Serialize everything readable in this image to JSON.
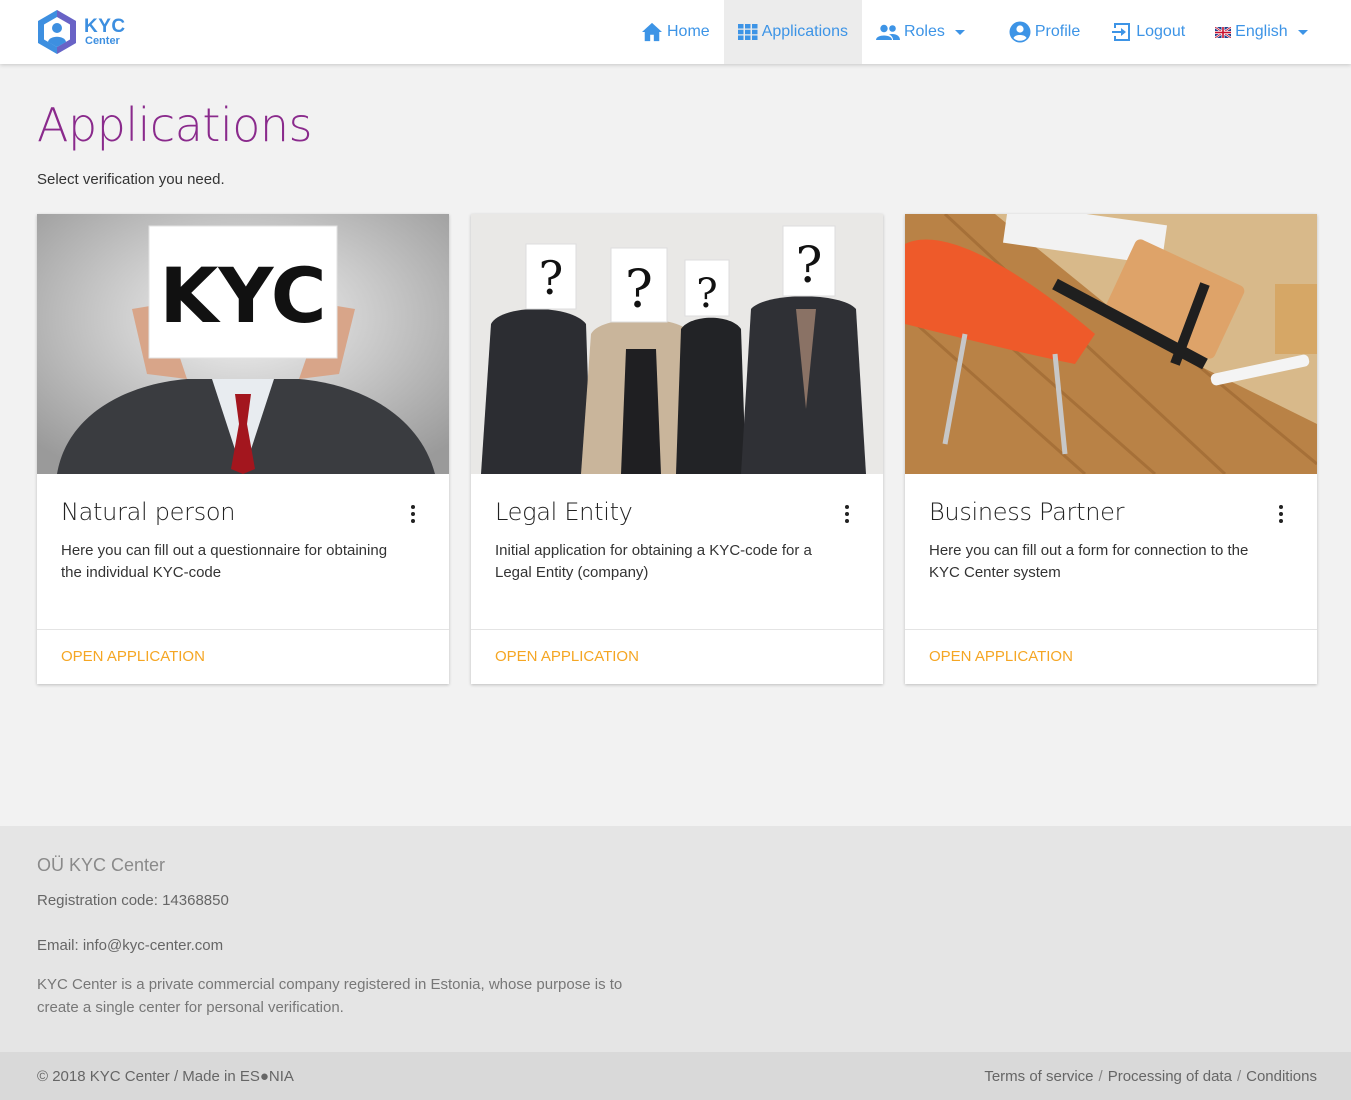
{
  "brand": {
    "line1": "KYC",
    "line2": "Center",
    "icon": "kyc-shield-logo",
    "color": "#3d8fe0"
  },
  "nav": {
    "items": [
      {
        "label": "Home",
        "icon": "home-icon"
      },
      {
        "label": "Applications",
        "icon": "apps-grid-icon",
        "active": true
      },
      {
        "label": "Roles",
        "icon": "people-icon",
        "dropdown": true
      },
      {
        "label": "Profile",
        "icon": "account-circle-icon"
      },
      {
        "label": "Logout",
        "icon": "logout-icon"
      },
      {
        "label": "English",
        "icon": "uk-flag-icon",
        "dropdown": true
      }
    ],
    "color": "#3d94e6"
  },
  "page": {
    "title": "Applications",
    "subtitle": "Select verification you need.",
    "title_color": "#8a2a8c"
  },
  "cards": [
    {
      "title": "Natural person",
      "description": "Here you can fill out a questionnaire for obtaining the individual KYC-code",
      "action": "OPEN APPLICATION",
      "image_sign_text": "KYC"
    },
    {
      "title": "Legal Entity",
      "description": "Initial application for obtaining a KYC-code for a Legal Entity (company)",
      "action": "OPEN APPLICATION",
      "image_sign_text": "?"
    },
    {
      "title": "Business Partner",
      "description": "Here you can fill out a form for connection to the KYC Center system",
      "action": "OPEN APPLICATION"
    }
  ],
  "action_color": "#f5a623",
  "footer": {
    "company": "OÜ KYC Center",
    "registration": "Registration code: 14368850",
    "email": "Email: info@kyc-center.com",
    "about": "KYC Center is a private commercial company registered in Estonia, whose purpose is to create a single center for personal verification.",
    "copyright": "© 2018 KYC Center / Made in ES●NIA",
    "links": [
      "Terms of service",
      "Processing of data",
      "Conditions"
    ],
    "link_separator": "/"
  }
}
